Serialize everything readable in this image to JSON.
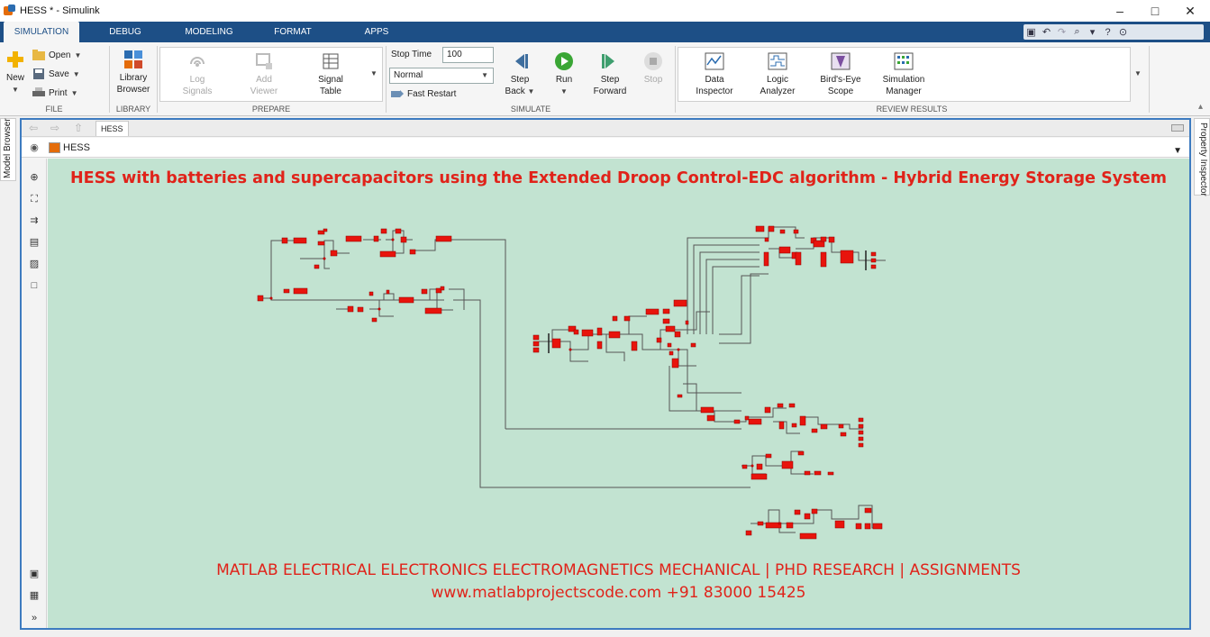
{
  "window": {
    "title": "HESS * - Simulink",
    "minimize": "–",
    "restore": "□",
    "close": "✕"
  },
  "tabs": [
    {
      "label": "SIMULATION",
      "active": true
    },
    {
      "label": "DEBUG"
    },
    {
      "label": "MODELING"
    },
    {
      "label": "FORMAT"
    },
    {
      "label": "APPS"
    }
  ],
  "quick_access_icons": [
    "save-icon",
    "undo-icon",
    "redo-icon",
    "search-icon",
    "help-dropdown-icon",
    "help-icon",
    "expand-icon"
  ],
  "ribbon": {
    "file": {
      "new_label": "New",
      "open_label": "Open",
      "save_label": "Save",
      "print_label": "Print",
      "group": "FILE"
    },
    "library": {
      "label_line1": "Library",
      "label_line2": "Browser",
      "group": "LIBRARY"
    },
    "prepare": {
      "log_line1": "Log",
      "log_line2": "Signals",
      "viewer_line1": "Add",
      "viewer_line2": "Viewer",
      "table_line1": "Signal",
      "table_line2": "Table",
      "group": "PREPARE"
    },
    "simulate": {
      "stop_time_label": "Stop Time",
      "stop_time_value": "100",
      "mode_value": "Normal",
      "fast_restart_label": "Fast Restart",
      "step_back_line1": "Step",
      "step_back_line2": "Back",
      "run_label": "Run",
      "step_forward_line1": "Step",
      "step_forward_line2": "Forward",
      "stop_label": "Stop",
      "group": "SIMULATE"
    },
    "review": {
      "data_line1": "Data",
      "data_line2": "Inspector",
      "logic_line1": "Logic",
      "logic_line2": "Analyzer",
      "birds_line1": "Bird's-Eye",
      "birds_line2": "Scope",
      "simmgr_line1": "Simulation",
      "simmgr_line2": "Manager",
      "group": "REVIEW RESULTS"
    }
  },
  "side_tabs": {
    "left": "Model Browser",
    "right": "Property Inspector"
  },
  "editor": {
    "model_tab": "HESS",
    "address": "HESS"
  },
  "canvas": {
    "title": "HESS with batteries and supercapacitors using the Extended Droop Control-EDC algorithm - Hybrid Energy Storage System",
    "footer_line1": "MATLAB ELECTRICAL ELECTRONICS ELECTROMAGNETICS MECHANICAL | PHD RESEARCH | ASSIGNMENTS",
    "footer_line2": "www.matlabprojectscode.com +91 83000 15425",
    "block_color": "#e8140c",
    "background_color": "#c2e3d1"
  },
  "colors": {
    "ribbon_tab_bar": "#1d4f86",
    "editor_border": "#3d7bc0"
  }
}
